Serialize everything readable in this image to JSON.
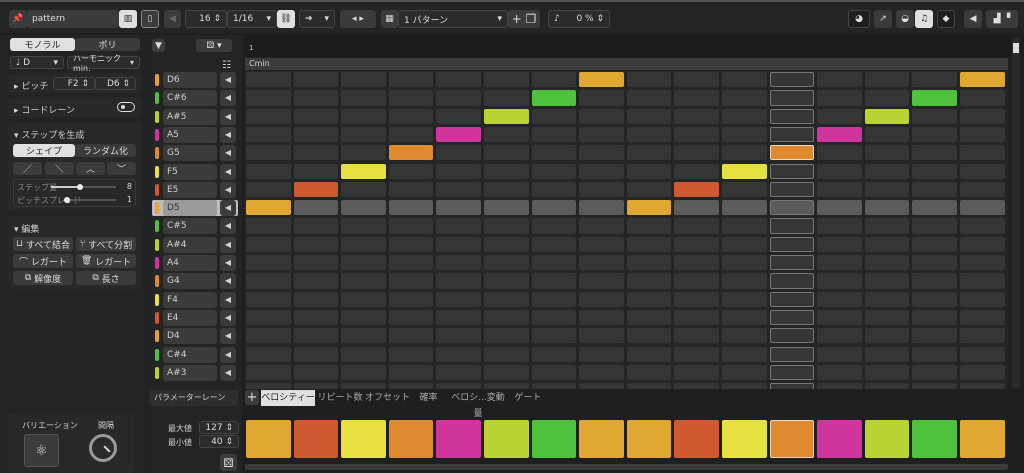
{
  "toolbar": {
    "title": "pattern",
    "steps": "16",
    "resolution": "1/16",
    "pattern": "1 パターン",
    "swing": "0 %"
  },
  "left": {
    "mono": "モノラル",
    "poly": "ポリ",
    "root": "D",
    "scale": "ハーモニック min.",
    "pitch_label": "ピッチ",
    "pitch_low": "F2",
    "pitch_high": "D6",
    "chord_lane": "コードレーン",
    "generate": "ステップを生成",
    "shape": "シェイプ",
    "randomize": "ランダム化",
    "step_amount_label": "ステップ量",
    "step_amount": "8",
    "pitch_spread_label": "ピッチスプレッド",
    "pitch_spread": "1",
    "edit": "編集",
    "join_all": "すべて結合",
    "split_all": "すべて分割",
    "legato1": "レガート",
    "legato2": "レガート",
    "resolution": "解像度",
    "length": "長さ",
    "variation": "バリエーション",
    "interval": "間隔"
  },
  "ruler": {
    "bar": "1",
    "chord": "Cmin"
  },
  "notes": [
    {
      "name": "D6",
      "color": "#e0a832"
    },
    {
      "name": "C#6",
      "color": "#4ec23a"
    },
    {
      "name": "A#5",
      "color": "#b8d432"
    },
    {
      "name": "A5",
      "color": "#d0359e"
    },
    {
      "name": "G5",
      "color": "#e08a30"
    },
    {
      "name": "F5",
      "color": "#e6e040"
    },
    {
      "name": "E5",
      "color": "#d05a30"
    },
    {
      "name": "D5",
      "color": "#e0a832"
    },
    {
      "name": "C#5",
      "color": "#4ec23a"
    },
    {
      "name": "A#4",
      "color": "#b8d432"
    },
    {
      "name": "A4",
      "color": "#d0359e"
    },
    {
      "name": "G4",
      "color": "#e08a30"
    },
    {
      "name": "F4",
      "color": "#e6e040"
    },
    {
      "name": "E4",
      "color": "#d05a30"
    },
    {
      "name": "D4",
      "color": "#e0a832"
    },
    {
      "name": "C#4",
      "color": "#4ec23a"
    },
    {
      "name": "A#3",
      "color": "#b8d432"
    }
  ],
  "selected_note": "D5",
  "steps": [
    "D5",
    "E5",
    "F5",
    "G5",
    "A5",
    "A#5",
    "C#6",
    "D6",
    "D5",
    "E5",
    "F5",
    "G5",
    "A5",
    "A#5",
    "C#6",
    "D6"
  ],
  "playhead_step": 11,
  "velocity": [
    127,
    127,
    127,
    127,
    127,
    127,
    127,
    127,
    127,
    127,
    127,
    127,
    127,
    127,
    127,
    127
  ],
  "param": {
    "lane_label": "パラメーターレーン",
    "tabs": [
      "ベロシティー",
      "リピート数",
      "オフセット",
      "確率",
      "ベロシ...変動量",
      "ゲート"
    ],
    "max_label": "最大値",
    "max": "127",
    "min_label": "最小値",
    "min": "40"
  }
}
